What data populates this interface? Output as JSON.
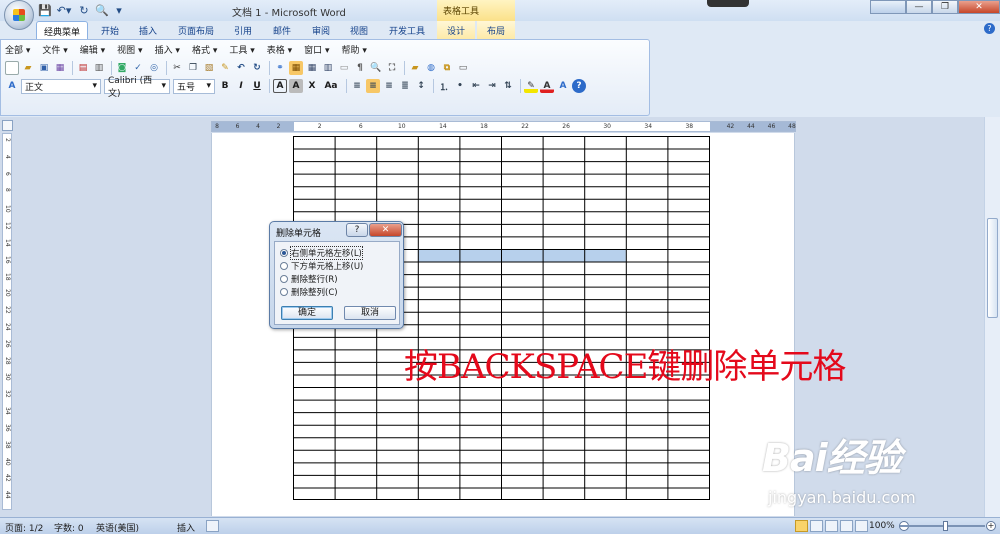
{
  "window": {
    "title": "文档 1 - Microsoft Word",
    "context_tab_group": "表格工具"
  },
  "ribbon_tabs": [
    {
      "label": "经典菜单",
      "active": true
    },
    {
      "label": "开始"
    },
    {
      "label": "插入"
    },
    {
      "label": "页面布局"
    },
    {
      "label": "引用"
    },
    {
      "label": "邮件"
    },
    {
      "label": "审阅"
    },
    {
      "label": "视图"
    },
    {
      "label": "开发工具"
    },
    {
      "label": "设计",
      "context": true
    },
    {
      "label": "布局",
      "context": true
    }
  ],
  "classic_menu": {
    "items": [
      "全部 ▾",
      "文件 ▾",
      "编辑 ▾",
      "视图 ▾",
      "插入 ▾",
      "格式 ▾",
      "工具 ▾",
      "表格 ▾",
      "窗口 ▾",
      "帮助 ▾"
    ],
    "style_combo": "正文",
    "font_combo": "Calibri (西文)",
    "size_combo": "五号"
  },
  "ruler": {
    "horizontal_ticks": [
      "8",
      "6",
      "4",
      "2",
      "",
      "2",
      "",
      "6",
      "",
      "10",
      "",
      "14",
      "",
      "18",
      "",
      "22",
      "",
      "26",
      "",
      "30",
      "",
      "34",
      "",
      "38",
      "",
      "42",
      "44",
      "46",
      "48"
    ],
    "vertical_ticks": [
      "2",
      "4",
      "6",
      "8",
      "10",
      "12",
      "14",
      "16",
      "18",
      "20",
      "22",
      "24",
      "26",
      "28",
      "30",
      "32",
      "34",
      "36",
      "38",
      "40",
      "42",
      "44"
    ]
  },
  "dialog": {
    "title": "删除单元格",
    "help_glyph": "?",
    "close_glyph": "✕",
    "options": [
      {
        "label": "右侧单元格左移(L)",
        "selected": true
      },
      {
        "label": "下方单元格上移(U)",
        "selected": false
      },
      {
        "label": "删除整行(R)",
        "selected": false
      },
      {
        "label": "删除整列(C)",
        "selected": false
      }
    ],
    "ok_label": "确定",
    "cancel_label": "取消"
  },
  "caption": "按BACKSPACE键删除单元格",
  "watermark": {
    "brand": "Bai经验",
    "url": "jingyan.baidu.com"
  },
  "status_bar": {
    "page": "页面: 1/2",
    "words": "字数: 0",
    "language": "英语(美国)",
    "mode": "插入",
    "zoom": "100%"
  },
  "colors": {
    "caption": "#e4091b",
    "selected_cells": "#b7d0ec",
    "context_tab": "#fbe189"
  }
}
